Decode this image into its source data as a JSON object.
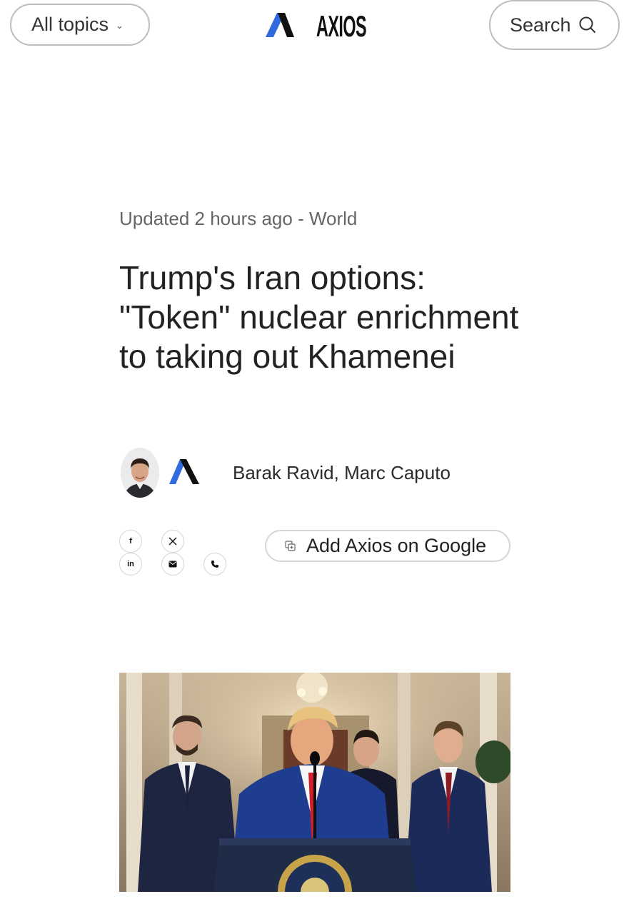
{
  "header": {
    "topics_label": "All topics",
    "brand": "AXIOS",
    "search_label": "Search"
  },
  "article": {
    "updated": "Updated 2 hours ago",
    "separator": " - ",
    "section": "World",
    "headline": "Trump's Iran options: \"Token\" nuclear enrichment to taking out Khamenei",
    "authors": "Barak Ravid, Marc Caputo"
  },
  "share": {
    "items": [
      "facebook-icon",
      "x-icon",
      "linkedin-icon",
      "email-icon",
      "phone-icon"
    ],
    "google_label": "Add Axios on Google"
  },
  "colors": {
    "brand_blue": "#2f6bde",
    "brand_black": "#111111",
    "text": "#222222",
    "muted": "#666666",
    "border": "#bdbdbd"
  }
}
